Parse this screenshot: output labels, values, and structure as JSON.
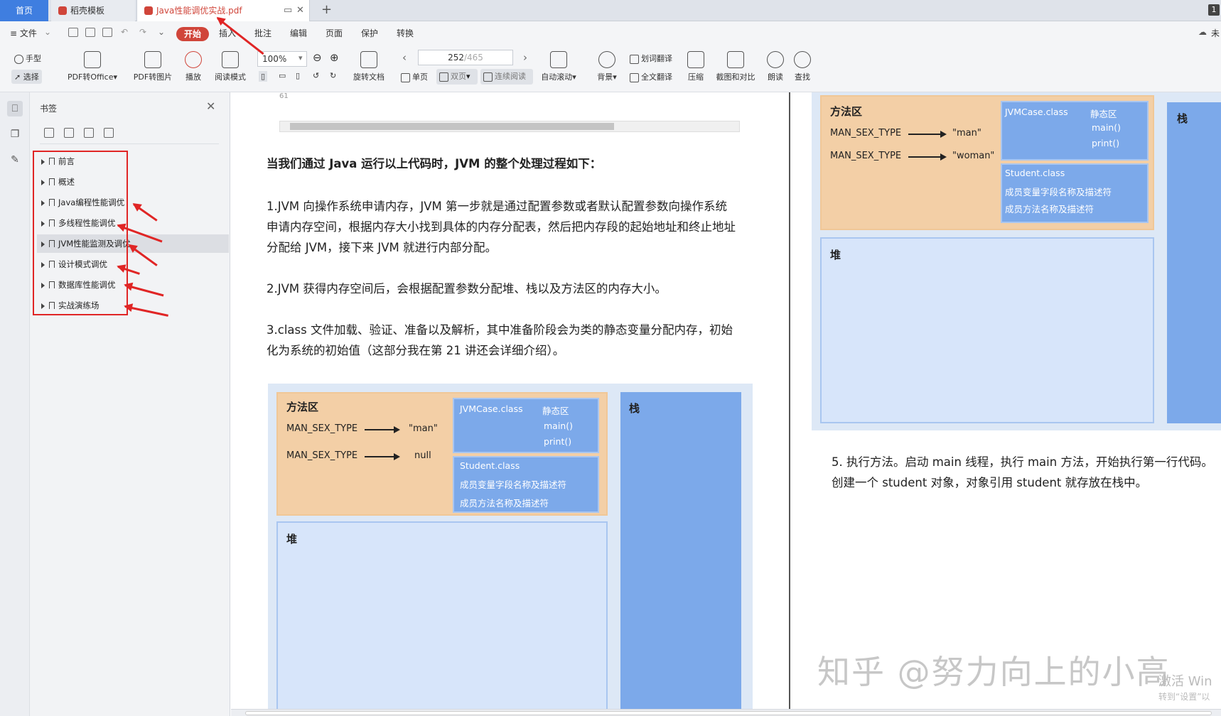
{
  "tabs": [
    {
      "label": "首页"
    },
    {
      "label": "稻壳模板"
    },
    {
      "label": "Java性能调优实战.pdf"
    }
  ],
  "corner_badge": "1",
  "menu": {
    "file": "≡ 文件",
    "start": "开始",
    "items": [
      "插入",
      "批注",
      "编辑",
      "页面",
      "保护",
      "转换"
    ],
    "cloud": "未"
  },
  "toolbar": {
    "hand": "手型",
    "select": "选择",
    "pdf_to_office": "PDF转Office",
    "pdf_to_image": "PDF转图片",
    "play": "播放",
    "read_mode": "阅读模式",
    "zoom": "100%",
    "rotate": "旋转文档",
    "page_current": "252",
    "page_total": "/465",
    "single": "单页",
    "double": "双页",
    "continuous": "连续阅读",
    "auto_scroll": "自动滚动",
    "background": "背景",
    "word_translate": "划词翻译",
    "full_translate": "全文翻译",
    "compress": "压缩",
    "screenshot_compare": "截图和对比",
    "read_aloud": "朗读",
    "find": "查找"
  },
  "bookmarks": {
    "title": "书签",
    "items": [
      {
        "label": "前言"
      },
      {
        "label": "概述"
      },
      {
        "label": "Java编程性能调优"
      },
      {
        "label": "多线程性能调优"
      },
      {
        "label": "JVM性能监测及调优"
      },
      {
        "label": "设计模式调优"
      },
      {
        "label": "数据库性能调优"
      },
      {
        "label": "实战演练场"
      }
    ]
  },
  "left_page": {
    "line_number": "61",
    "heading": "当我们通过 Java 运行以上代码时，JVM 的整个处理过程如下：",
    "p1": [
      "1.JVM 向操作系统申请内存，JVM 第一步就是通过配置参数或者默认配置参数向操作系统",
      "申请内存空间，根据内存大小找到具体的内存分配表，然后把内存段的起始地址和终止地址",
      "分配给 JVM，接下来 JVM 就进行内部分配。"
    ],
    "p2": "2.JVM 获得内存空间后，会根据配置参数分配堆、栈以及方法区的内存大小。",
    "p3": [
      "3.class 文件加载、验证、准备以及解析，其中准备阶段会为类的静态变量分配内存，初始",
      "化为系统的初始值（这部分我在第 21 讲还会详细介绍）。"
    ],
    "diagram": {
      "method_area": "方法区",
      "row1_left": "MAN_SEX_TYPE",
      "row1_right": "\"man\"",
      "row2_left": "MAN_SEX_TYPE",
      "row2_right": "null",
      "class1": "JVMCase.class",
      "static_area": "静态区",
      "m1": "main()",
      "m2": "print()",
      "class2": "Student.class",
      "c2line1": "成员变量字段名称及描述符",
      "c2line2": "成员方法名称及描述符",
      "heap": "堆",
      "stack": "栈"
    }
  },
  "right_page": {
    "diagram": {
      "method_area": "方法区",
      "row1_left": "MAN_SEX_TYPE",
      "row1_right": "\"man\"",
      "row2_left": "MAN_SEX_TYPE",
      "row2_right": "\"woman\"",
      "class1": "JVMCase.class",
      "static_area": "静态区",
      "m1": "main()",
      "m2": "print()",
      "class2": "Student.class",
      "c2line1": "成员变量字段名称及描述符",
      "c2line2": "成员方法名称及描述符",
      "heap": "堆",
      "stack": "栈"
    },
    "p5": [
      "5. 执行方法。启动 main 线程，执行 main 方法，开始执行第一行代码。",
      "创建一个 student 对象，对象引用 student 就存放在栈中。"
    ]
  },
  "watermark": "知乎 @努力向上的小高",
  "activation": {
    "line1": "激活 Win",
    "line2": "转到“设置”以"
  },
  "colors": {
    "accent": "#d0453a",
    "annotation": "#e02525",
    "method_area": "#f3cfa6",
    "class_box": "#7ca9ea",
    "heap": "#d7e5fa"
  }
}
